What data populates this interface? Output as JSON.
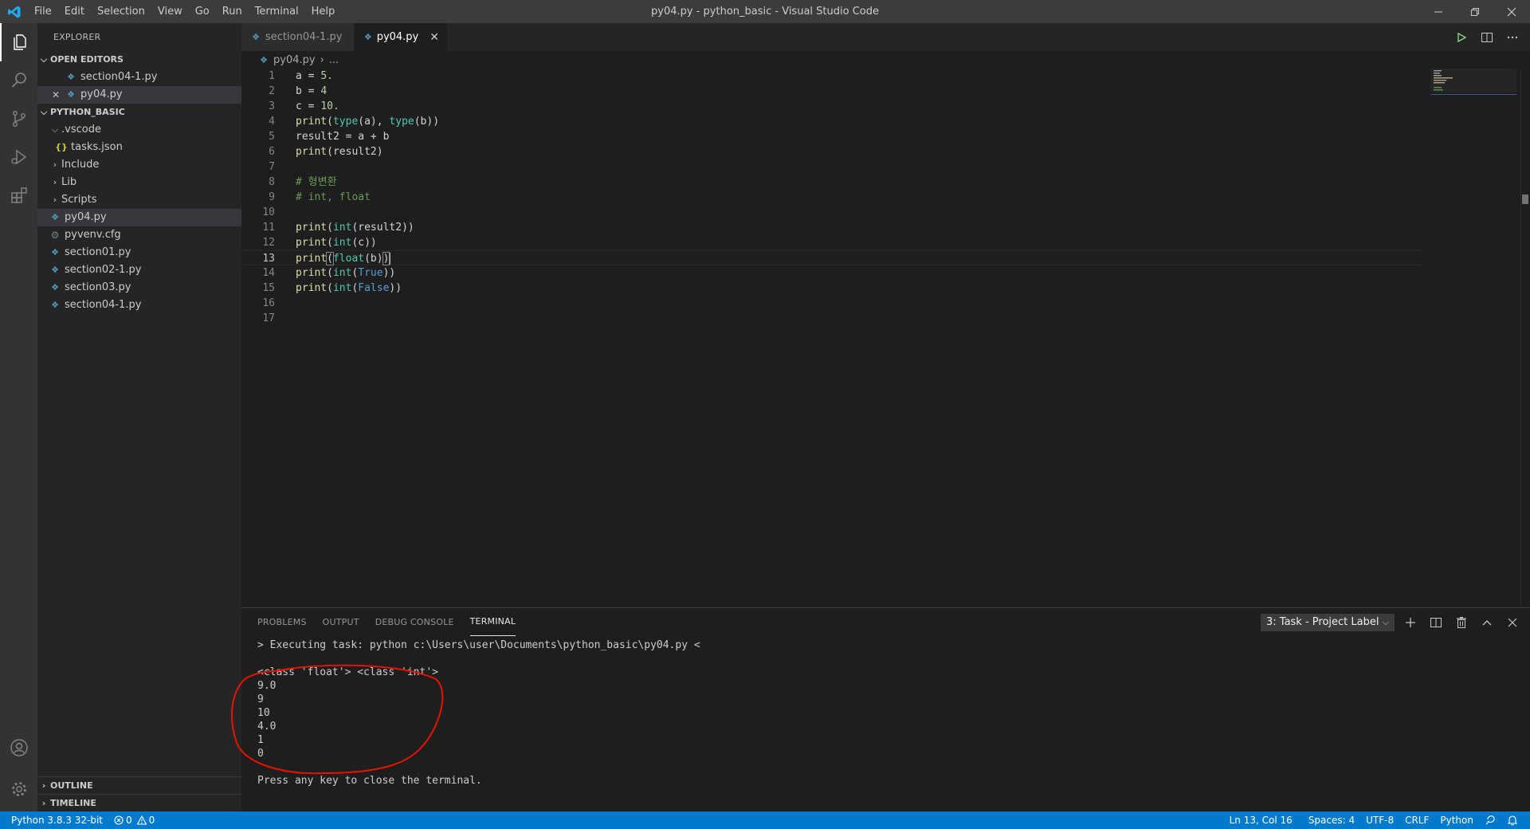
{
  "window": {
    "title": "py04.py - python_basic - Visual Studio Code",
    "menu": [
      "File",
      "Edit",
      "Selection",
      "View",
      "Go",
      "Run",
      "Terminal",
      "Help"
    ]
  },
  "sidebar": {
    "title": "EXPLORER",
    "open_editors_label": "OPEN EDITORS",
    "open_editors": [
      "section04-1.py",
      "py04.py"
    ],
    "project_label": "PYTHON_BASIC",
    "tree": {
      "vscode": ".vscode",
      "tasks": "tasks.json",
      "include": "Include",
      "lib": "Lib",
      "scripts": "Scripts",
      "py04": "py04.py",
      "pyvenv": "pyvenv.cfg",
      "section01": "section01.py",
      "section02": "section02-1.py",
      "section03": "section03.py",
      "section04": "section04-1.py"
    },
    "outline_label": "OUTLINE",
    "timeline_label": "TIMELINE"
  },
  "tabs": [
    {
      "label": "section04-1.py"
    },
    {
      "label": "py04.py"
    }
  ],
  "breadcrumb": {
    "file": "py04.py",
    "rest": "..."
  },
  "editor": {
    "line_numbers": [
      "1",
      "2",
      "3",
      "4",
      "5",
      "6",
      "7",
      "8",
      "9",
      "10",
      "11",
      "12",
      "13",
      "14",
      "15",
      "16",
      "17"
    ],
    "current_line": "13"
  },
  "panel": {
    "tabs": [
      "PROBLEMS",
      "OUTPUT",
      "DEBUG CONSOLE",
      "TERMINAL"
    ],
    "terminal_select": "3: Task - Project Label",
    "terminal_lines": [
      "> Executing task: python c:\\Users\\user\\Documents\\python_basic\\py04.py <",
      "",
      "<class 'float'> <class 'int'>",
      "9.0",
      "9",
      "10",
      "4.0",
      "1",
      "0",
      "",
      "Press any key to close the terminal."
    ]
  },
  "statusbar": {
    "interpreter": "Python 3.8.3 32-bit",
    "errors": "0",
    "warnings": "0",
    "position": "Ln 13, Col 16",
    "spaces": "Spaces: 4",
    "encoding": "UTF-8",
    "eol": "CRLF",
    "language": "Python"
  },
  "colors": {
    "statusbar": "#007acc",
    "activitybar": "#333333",
    "sidebar": "#252526",
    "editor": "#1e1e1e",
    "annotation": "#e51400"
  }
}
